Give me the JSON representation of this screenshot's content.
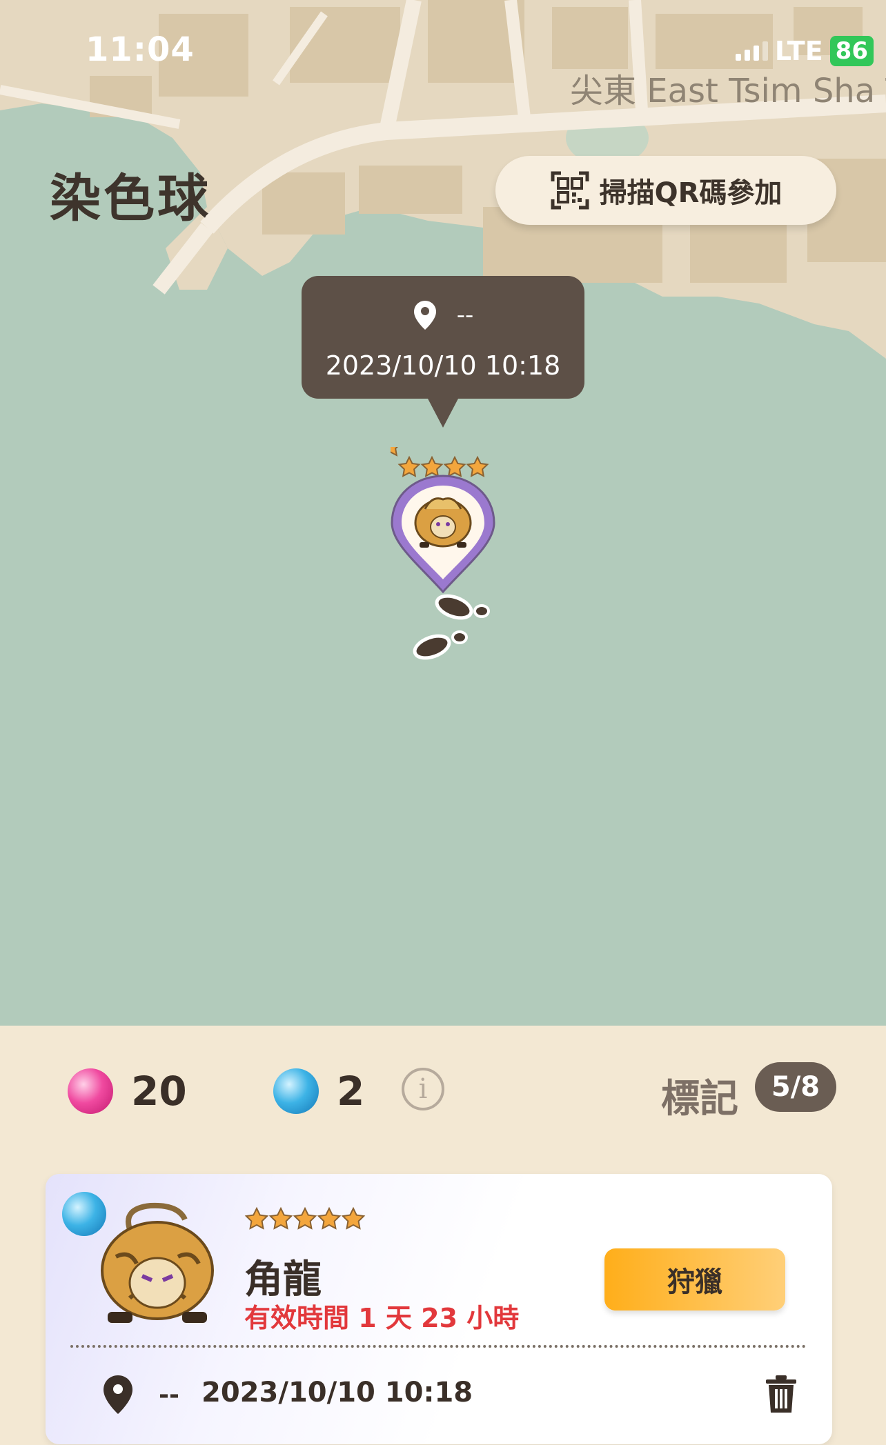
{
  "status_bar": {
    "time": "11:04",
    "network": "LTE",
    "battery": "86"
  },
  "map": {
    "place_label": "尖東 East Tsim Sha T",
    "tooltip": {
      "location": "--",
      "datetime": "2023/10/10 10:18"
    },
    "marker": {
      "stars": 4,
      "icon": "monster-icon"
    },
    "icons": [
      "pin-icon",
      "footprints-icon",
      "qr-code-icon"
    ]
  },
  "header": {
    "title": "染色球",
    "qr_button": "掃描QR碼參加"
  },
  "stats": {
    "pink_orbs": "20",
    "blue_orbs": "2",
    "mark_label": "標記",
    "mark_count": "5/8"
  },
  "card": {
    "stars": 5,
    "name": "角龍",
    "validity": "有效時間 1 天 23 小時",
    "hunt_button": "狩獵",
    "location": "--",
    "datetime": "2023/10/10 10:18"
  },
  "colors": {
    "map_water": "#b2cbbb",
    "map_land": "#e8dac3",
    "tooltip_bg": "#5d5047",
    "panel_bg": "#f3e8d3",
    "accent_orange": "#ffae1a",
    "validity_red": "#e2383c",
    "marker_purple": "#9b79cf"
  }
}
